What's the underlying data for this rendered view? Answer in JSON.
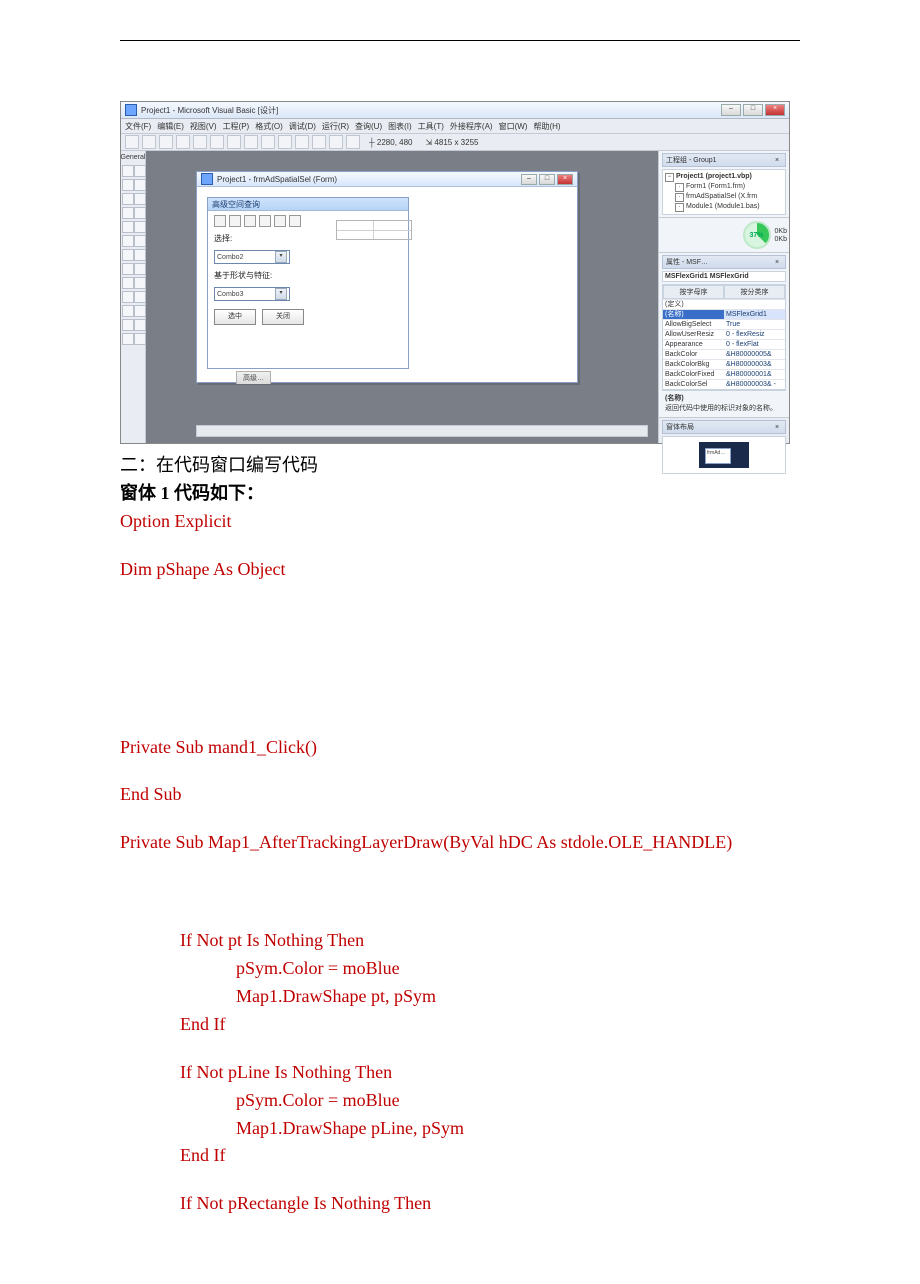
{
  "ide": {
    "title": "Project1 - Microsoft Visual Basic [设计]",
    "menu": [
      "文件(F)",
      "编辑(E)",
      "视图(V)",
      "工程(P)",
      "格式(O)",
      "调试(D)",
      "运行(R)",
      "查询(U)",
      "图表(I)",
      "工具(T)",
      "外接程序(A)",
      "窗口(W)",
      "帮助(H)"
    ],
    "coords_a": "2280, 480",
    "coords_b": "4815 x 3255",
    "toolbox_head": "General",
    "form_window_title": "Project1 - frmAdSpatialSel (Form)",
    "inner_form_title": "高级空间查询",
    "lbl_select": "选择:",
    "combo2": "Combo2",
    "lbl_shape": "基于形状与特征:",
    "combo3": "Combo3",
    "btn_selzhong": "选中",
    "btn_close": "关闭",
    "tab_inner": "高级…",
    "project_panel": {
      "title": "工程组 - Group1",
      "root": "Project1 (project1.vbp)",
      "n1": "Form1 (Form1.frm)",
      "n2": "frmAdSpatialSel (X.frm",
      "n3": "Module1 (Module1.bas)"
    },
    "gauge": "37%",
    "gauge_r1": "0Kb",
    "gauge_r2": "0Kb",
    "props": {
      "title": "属性 - MSF…",
      "grid_name": "MSFlexGrid1 MSFlexGrid",
      "tab1": "按字母序",
      "tab2": "按分类序",
      "custom": "(定义)",
      "nameK": "(名称)",
      "nameV": "MSFlexGrid1",
      "rows": [
        [
          "AllowBigSelect",
          "True"
        ],
        [
          "AllowUserResiz",
          "0 - flexResiz"
        ],
        [
          "Appearance",
          "0 - flexFlat"
        ],
        [
          "BackColor",
          "&H80000005&"
        ],
        [
          "BackColorBkg",
          "&H80000003&"
        ],
        [
          "BackColorFixed",
          "&H80000001&"
        ],
        [
          "BackColorSel",
          "&H80000003& -"
        ]
      ],
      "desc_head": "(名称)",
      "desc_body": "返回代码中使用的标识对象的名称。"
    },
    "layout_title": "窗体布局",
    "layout_form": "frmAd…"
  },
  "doc": {
    "caption": "二：在代码窗口编写代码",
    "subhead_pre": "窗体",
    "subhead_num": "1",
    "subhead_post": "代码如下：",
    "c1": "Option Explicit",
    "c2": "Dim pShape As Object",
    "c3": "Private Sub mand1_Click()",
    "c4": "End Sub",
    "c5": "Private Sub Map1_AfterTrackingLayerDraw(ByVal hDC As stdole.OLE_HANDLE)",
    "b1": "If Not pt Is Nothing Then",
    "b1a": "pSym.Color = moBlue",
    "b1b": "Map1.DrawShape pt, pSym",
    "b1e": "End If",
    "b2": "If Not pLine Is Nothing Then",
    "b2a": "pSym.Color = moBlue",
    "b2b": "Map1.DrawShape pLine, pSym",
    "b2e": "End If",
    "b3": "If Not pRectangle Is Nothing Then"
  }
}
